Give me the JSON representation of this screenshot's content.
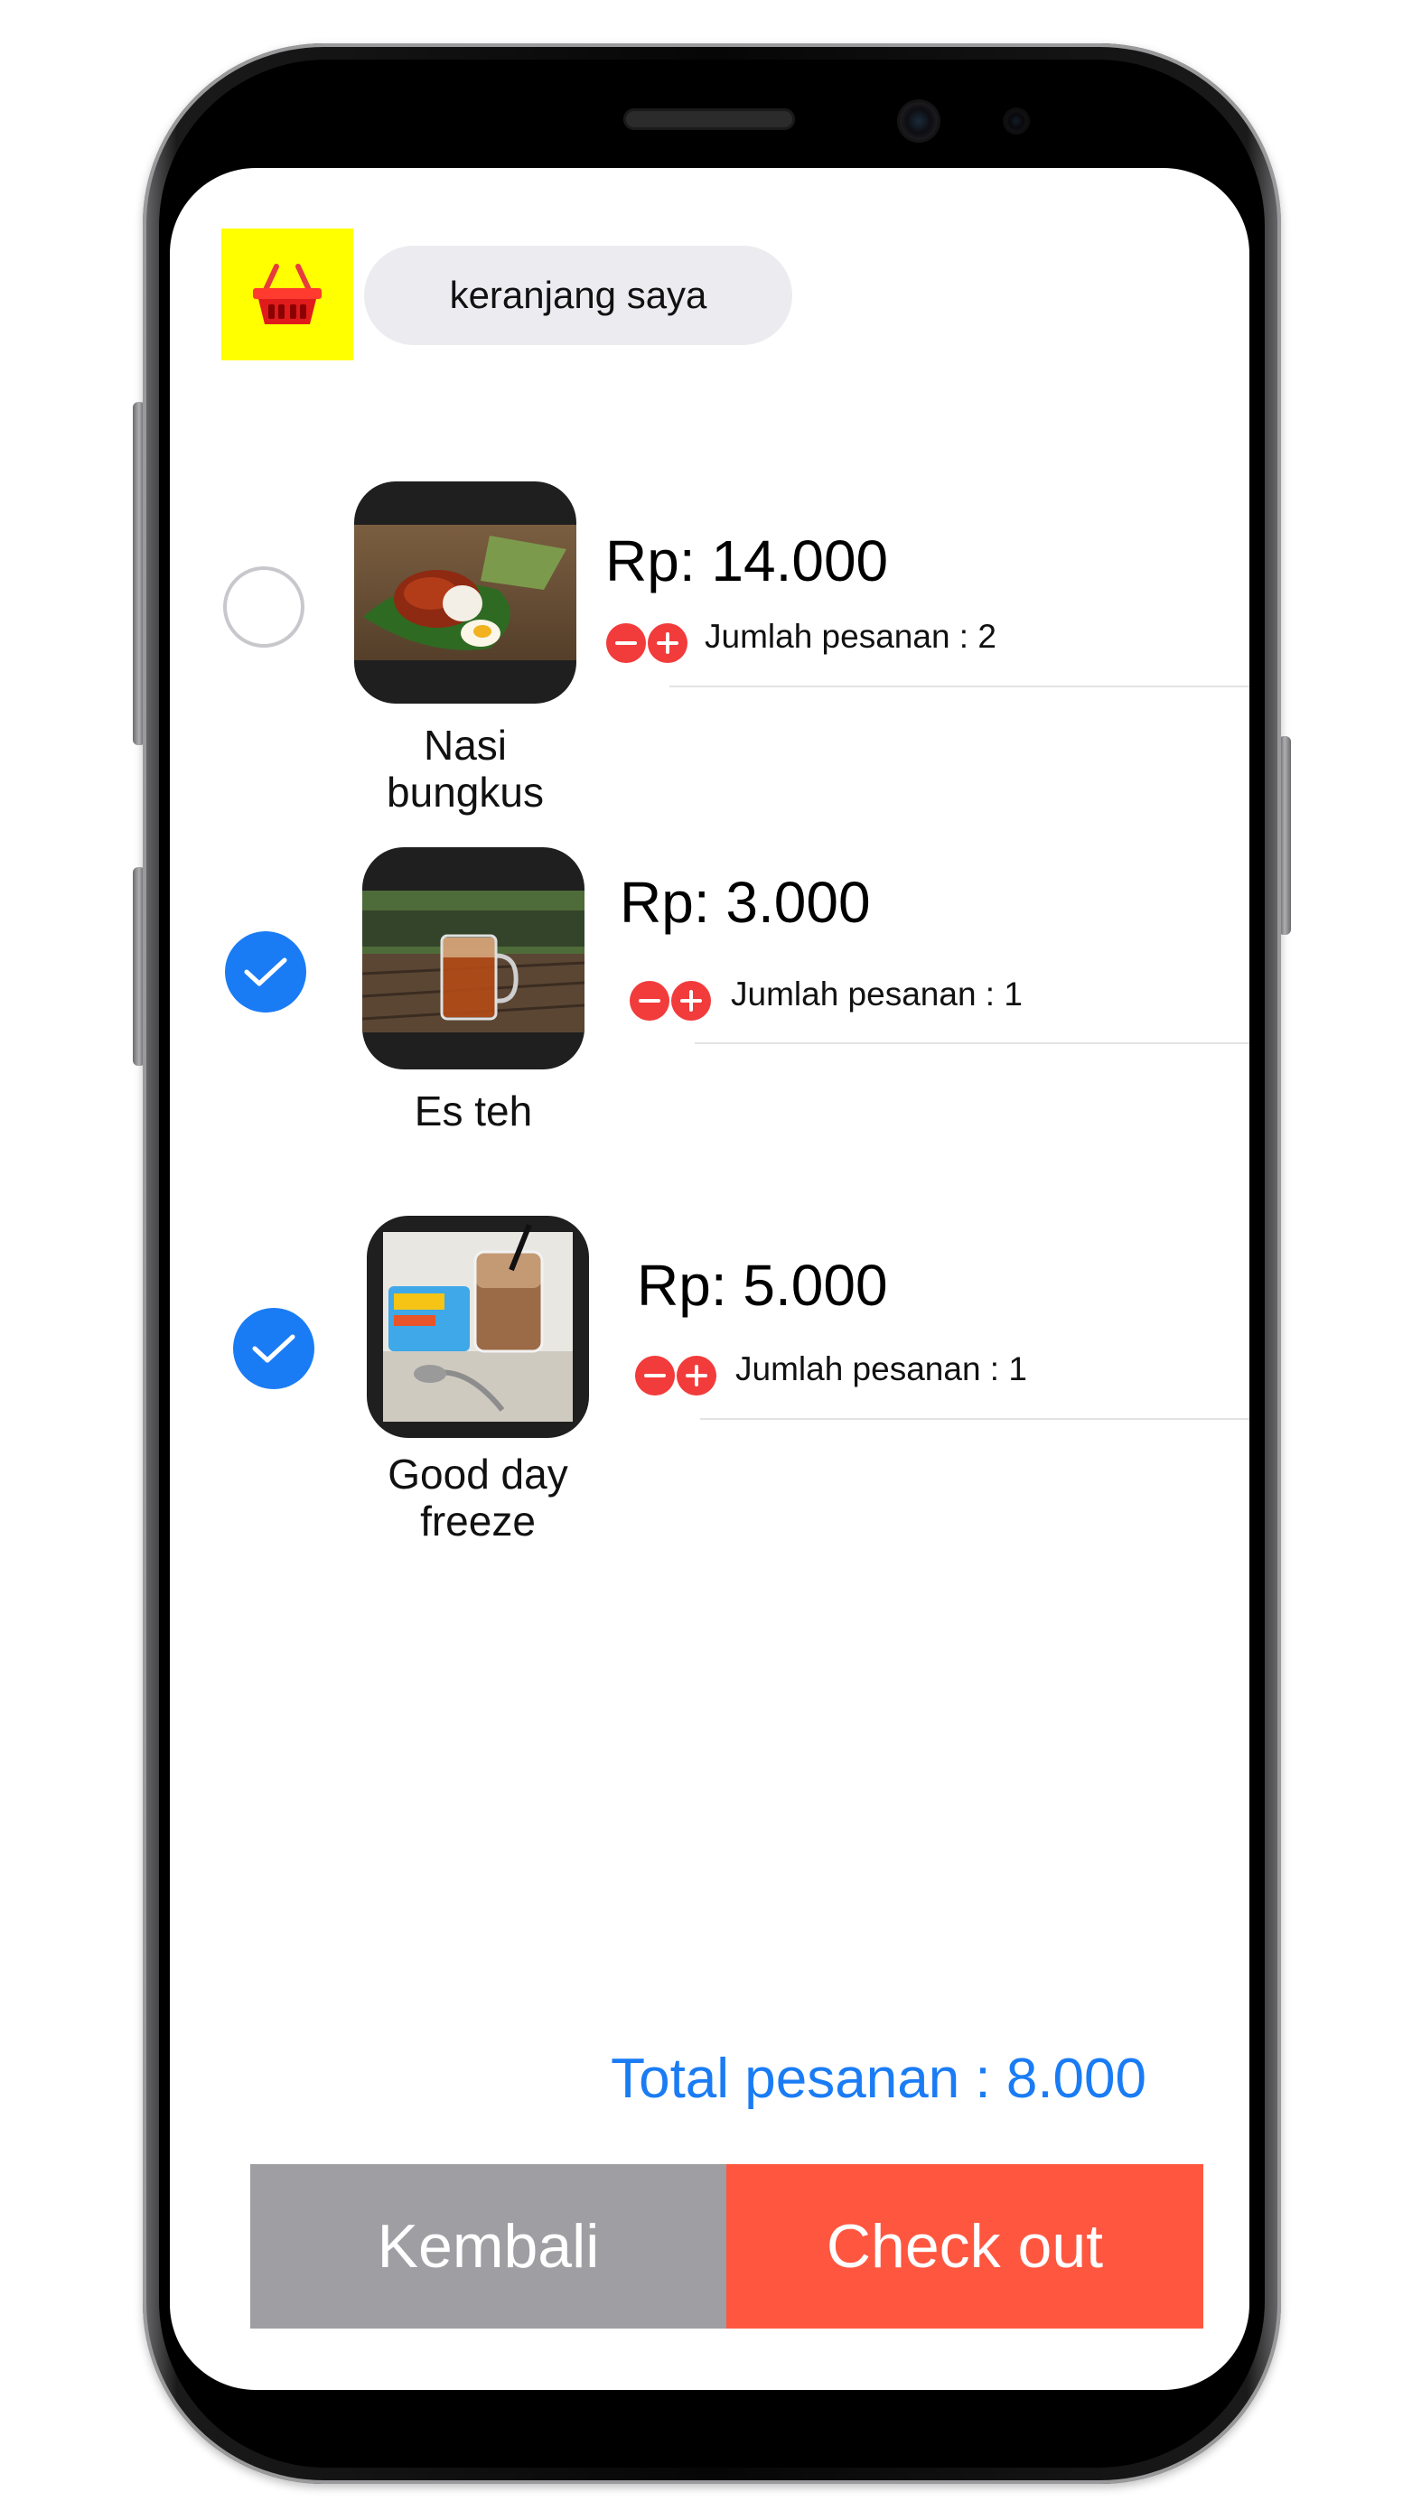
{
  "header": {
    "title": "keranjang saya",
    "icon": "shopping-basket-icon"
  },
  "cart": {
    "items": [
      {
        "name": "Nasi bungkus",
        "price": "Rp: 14.000",
        "quantity_text": "Jumlah pesanan : 2",
        "selected": false
      },
      {
        "name": "Es teh",
        "price": "Rp: 3.000",
        "quantity_text": "Jumlah pesanan : 1",
        "selected": true
      },
      {
        "name": "Good day freeze",
        "price": "Rp: 5.000",
        "quantity_text": "Jumlah pesanan : 1",
        "selected": true
      }
    ]
  },
  "summary": {
    "total_text": "Total pesanan : 8.000"
  },
  "actions": {
    "back_label": "Kembali",
    "checkout_label": "Check out"
  },
  "colors": {
    "accent_blue": "#1a7cf5",
    "checkout_red": "#ff5640",
    "back_grey": "#9e9ea3",
    "basket_bg": "#ffff00",
    "qty_button_red": "#f23b3b"
  }
}
